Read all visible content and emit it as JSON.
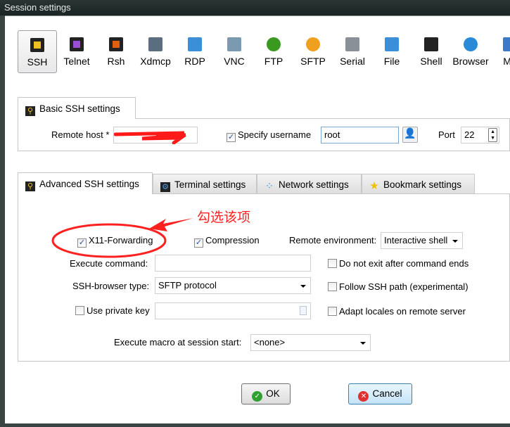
{
  "window": {
    "title": "Session settings"
  },
  "protocols": [
    {
      "label": "SSH",
      "icon": "key-icon",
      "color": "#f0c020",
      "selected": true
    },
    {
      "label": "Telnet",
      "icon": "gem-icon",
      "color": "#9a4fd8"
    },
    {
      "label": "Rsh",
      "icon": "gears-icon",
      "color": "#e06010"
    },
    {
      "label": "Xdmcp",
      "icon": "x-monitor-icon",
      "color": "#5a6e80"
    },
    {
      "label": "RDP",
      "icon": "windows-monitor-icon",
      "color": "#3a8fd8"
    },
    {
      "label": "VNC",
      "icon": "vnc-monitor-icon",
      "color": "#7a9ab0"
    },
    {
      "label": "FTP",
      "icon": "green-globe-icon",
      "color": "#3a9a20"
    },
    {
      "label": "SFTP",
      "icon": "orange-globe-icon",
      "color": "#f0a020"
    },
    {
      "label": "Serial",
      "icon": "plug-icon",
      "color": "#8a9098"
    },
    {
      "label": "File",
      "icon": "file-monitor-icon",
      "color": "#3a8fd8"
    },
    {
      "label": "Shell",
      "icon": "terminal-icon",
      "color": "#222222"
    },
    {
      "label": "Browser",
      "icon": "globe-icon",
      "color": "#2a8ad8"
    },
    {
      "label": "Mo",
      "icon": "satellite-icon",
      "color": "#3a7ac8"
    }
  ],
  "basic": {
    "tab": "Basic SSH settings",
    "remote_host_label": "Remote host *",
    "remote_host_value": "",
    "specify_username_label": "Specify username",
    "specify_username_checked": true,
    "username": "root",
    "port_label": "Port",
    "port": "22"
  },
  "advanced_tabs": [
    "Advanced SSH settings",
    "Terminal settings",
    "Network settings",
    "Bookmark settings"
  ],
  "advanced": {
    "x11_label": "X11-Forwarding",
    "x11_checked": true,
    "compression_label": "Compression",
    "compression_checked": true,
    "remote_env_label": "Remote environment:",
    "remote_env_value": "Interactive shell",
    "exec_cmd_label": "Execute command:",
    "exec_cmd_value": "",
    "do_not_exit_label": "Do not exit after command ends",
    "browser_type_label": "SSH-browser type:",
    "browser_type_value": "SFTP protocol",
    "follow_path_label": "Follow SSH path (experimental)",
    "private_key_label": "Use private key",
    "private_key_value": "",
    "adapt_locales_label": "Adapt locales on remote server",
    "macro_label": "Execute macro at session start:",
    "macro_value": "<none>"
  },
  "annotation": {
    "text": "勾选该项",
    "color": "#ff2020"
  },
  "buttons": {
    "ok": "OK",
    "cancel": "Cancel"
  }
}
